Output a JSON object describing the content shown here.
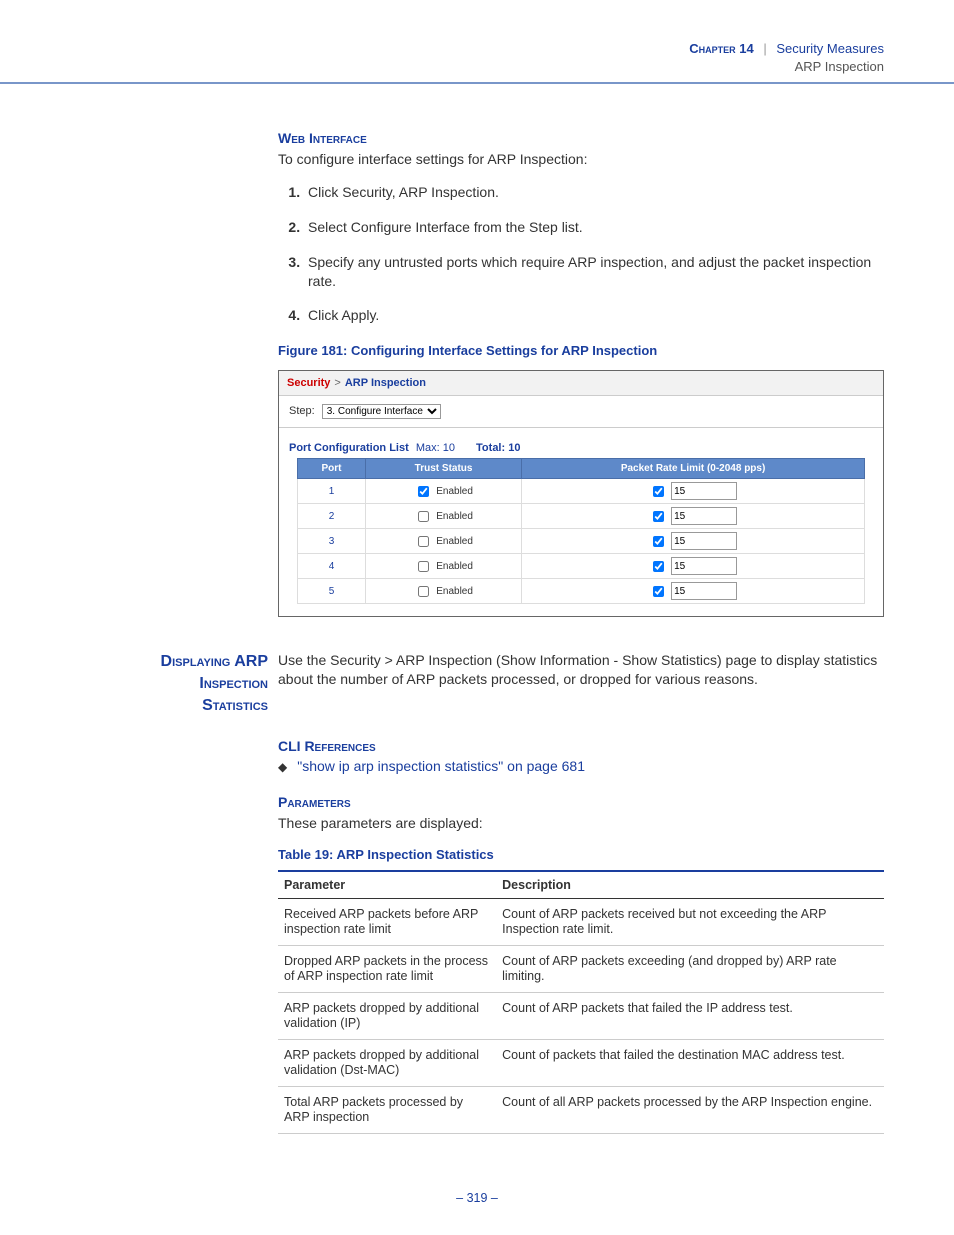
{
  "header": {
    "chapter_label": "Chapter 14",
    "separator": "|",
    "title": "Security Measures",
    "subtitle": "ARP Inspection"
  },
  "web_interface": {
    "heading": "Web Interface",
    "intro": "To configure interface settings for ARP Inspection:",
    "steps": [
      "Click Security, ARP Inspection.",
      "Select Configure Interface from the Step list.",
      "Specify any untrusted ports which require ARP inspection, and adjust the packet inspection rate.",
      "Click Apply."
    ]
  },
  "figure": {
    "caption": "Figure 181:  Configuring Interface Settings for ARP Inspection",
    "breadcrumb_security": "Security",
    "breadcrumb_page": "ARP Inspection",
    "step_label": "Step:",
    "step_value": "3. Configure Interface",
    "list_label": "Port Configuration List",
    "max_label": "Max: 10",
    "total_label": "Total: 10",
    "columns": {
      "port": "Port",
      "trust": "Trust Status",
      "rate": "Packet Rate Limit (0-2048 pps)"
    },
    "enabled_label": "Enabled",
    "rows": [
      {
        "port": "1",
        "trust": true,
        "rate_enabled": true,
        "rate": "15"
      },
      {
        "port": "2",
        "trust": false,
        "rate_enabled": true,
        "rate": "15"
      },
      {
        "port": "3",
        "trust": false,
        "rate_enabled": true,
        "rate": "15"
      },
      {
        "port": "4",
        "trust": false,
        "rate_enabled": true,
        "rate": "15"
      },
      {
        "port": "5",
        "trust": false,
        "rate_enabled": true,
        "rate": "15"
      }
    ]
  },
  "section2": {
    "left_heading_l1": "Displaying ARP",
    "left_heading_l2": "Inspection",
    "left_heading_l3": "Statistics",
    "body": "Use the Security > ARP Inspection (Show Information - Show Statistics) page to display statistics about the number of ARP packets processed, or dropped for various reasons."
  },
  "cli_refs": {
    "heading": "CLI References",
    "link_text": "\"show ip arp inspection statistics\" on page 681"
  },
  "parameters": {
    "heading": "Parameters",
    "intro": "These parameters are displayed:",
    "table_title": "Table 19: ARP Inspection Statistics",
    "header_param": "Parameter",
    "header_desc": "Description",
    "rows": [
      {
        "param": "Received ARP packets before ARP inspection rate limit",
        "desc": "Count of ARP packets received but not exceeding the ARP Inspection rate limit."
      },
      {
        "param": "Dropped ARP packets in the process of ARP inspection rate limit",
        "desc": "Count of ARP packets exceeding (and dropped by) ARP rate limiting."
      },
      {
        "param": "ARP packets dropped by additional validation (IP)",
        "desc": "Count of ARP packets that failed the IP address test."
      },
      {
        "param": "ARP packets dropped by additional validation (Dst-MAC)",
        "desc": "Count of packets that failed the destination MAC address test."
      },
      {
        "param": "Total ARP packets processed by ARP inspection",
        "desc": "Count of all ARP packets processed by the ARP Inspection engine."
      }
    ]
  },
  "page_number": "–  319  –"
}
